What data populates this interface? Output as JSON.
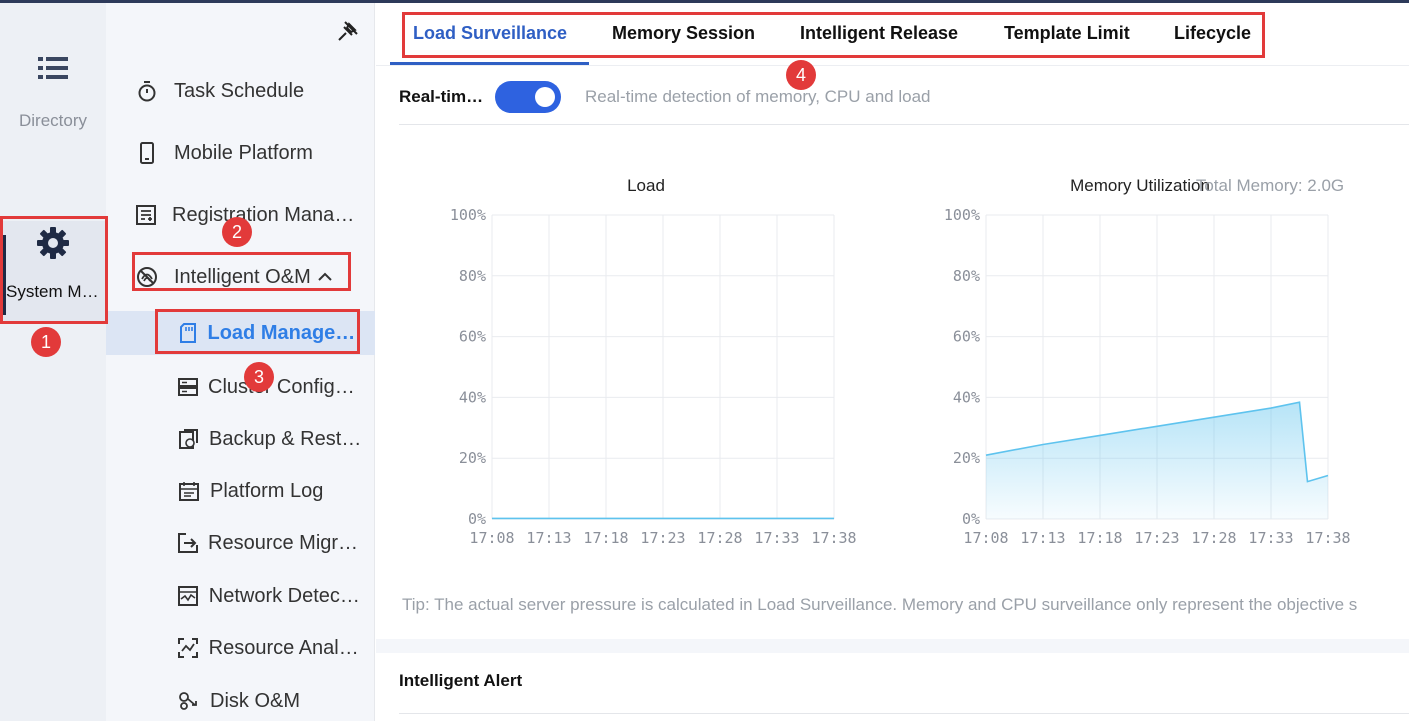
{
  "rail": {
    "directory_label": "Directory",
    "system_label": "System Management"
  },
  "tree": {
    "items": [
      {
        "label": "Task Schedule",
        "icon": "stopwatch-icon"
      },
      {
        "label": "Mobile Platform",
        "icon": "mobile-icon"
      },
      {
        "label": "Registration Management",
        "icon": "registration-icon"
      },
      {
        "label": "Intelligent O&M",
        "icon": "om-icon"
      }
    ],
    "children": [
      {
        "label": "Load Management",
        "icon": "sd-card-icon"
      },
      {
        "label": "Cluster Configuration",
        "icon": "server-icon"
      },
      {
        "label": "Backup & Restore",
        "icon": "backup-icon"
      },
      {
        "label": "Platform Log",
        "icon": "log-icon"
      },
      {
        "label": "Resource Migration",
        "icon": "migration-icon"
      },
      {
        "label": "Network Detection",
        "icon": "network-icon"
      },
      {
        "label": "Resource Analysis",
        "icon": "analysis-icon"
      },
      {
        "label": "Disk O&M",
        "icon": "disk-icon"
      }
    ]
  },
  "tabs": [
    {
      "label": "Load Surveillance"
    },
    {
      "label": "Memory Session"
    },
    {
      "label": "Intelligent Release"
    },
    {
      "label": "Template Limit"
    },
    {
      "label": "Lifecycle"
    }
  ],
  "realtime": {
    "label": "Real-time Detection",
    "enabled": true,
    "description": "Real-time detection of memory, CPU and load"
  },
  "tip": "Tip: The actual server pressure is calculated in Load Surveillance. Memory and CPU surveillance only represent the objective s",
  "alert_title": "Intelligent Alert",
  "annotations": [
    "1",
    "2",
    "3",
    "4"
  ],
  "colors": {
    "accent": "#2f5fc4",
    "annotation": "#e23a3a",
    "series": "#5ec3ee"
  },
  "chart_data": [
    {
      "type": "line",
      "title": "Load",
      "x": [
        "17:08",
        "17:13",
        "17:18",
        "17:23",
        "17:28",
        "17:33",
        "17:38"
      ],
      "y_ticks": [
        "0%",
        "20%",
        "40%",
        "60%",
        "80%",
        "100%"
      ],
      "ylim": [
        0,
        100
      ],
      "grid": true,
      "series": [
        {
          "points": [
            [
              0,
              0.2
            ],
            [
              30,
              0.2
            ]
          ]
        }
      ]
    },
    {
      "type": "area",
      "title": "Memory Utilization",
      "subtitle": "Total Memory: 2.0G",
      "x": [
        "17:08",
        "17:13",
        "17:18",
        "17:23",
        "17:28",
        "17:33",
        "17:38"
      ],
      "y_ticks": [
        "0%",
        "20%",
        "40%",
        "60%",
        "80%",
        "100%"
      ],
      "ylim": [
        0,
        100
      ],
      "grid": true,
      "series": [
        {
          "points": [
            [
              0,
              21
            ],
            [
              5,
              24.5
            ],
            [
              10,
              27.5
            ],
            [
              15,
              30.5
            ],
            [
              20,
              33.5
            ],
            [
              25,
              36.5
            ],
            [
              27.5,
              38.4
            ],
            [
              28.2,
              12.3
            ],
            [
              30,
              14.3
            ]
          ]
        }
      ]
    }
  ]
}
